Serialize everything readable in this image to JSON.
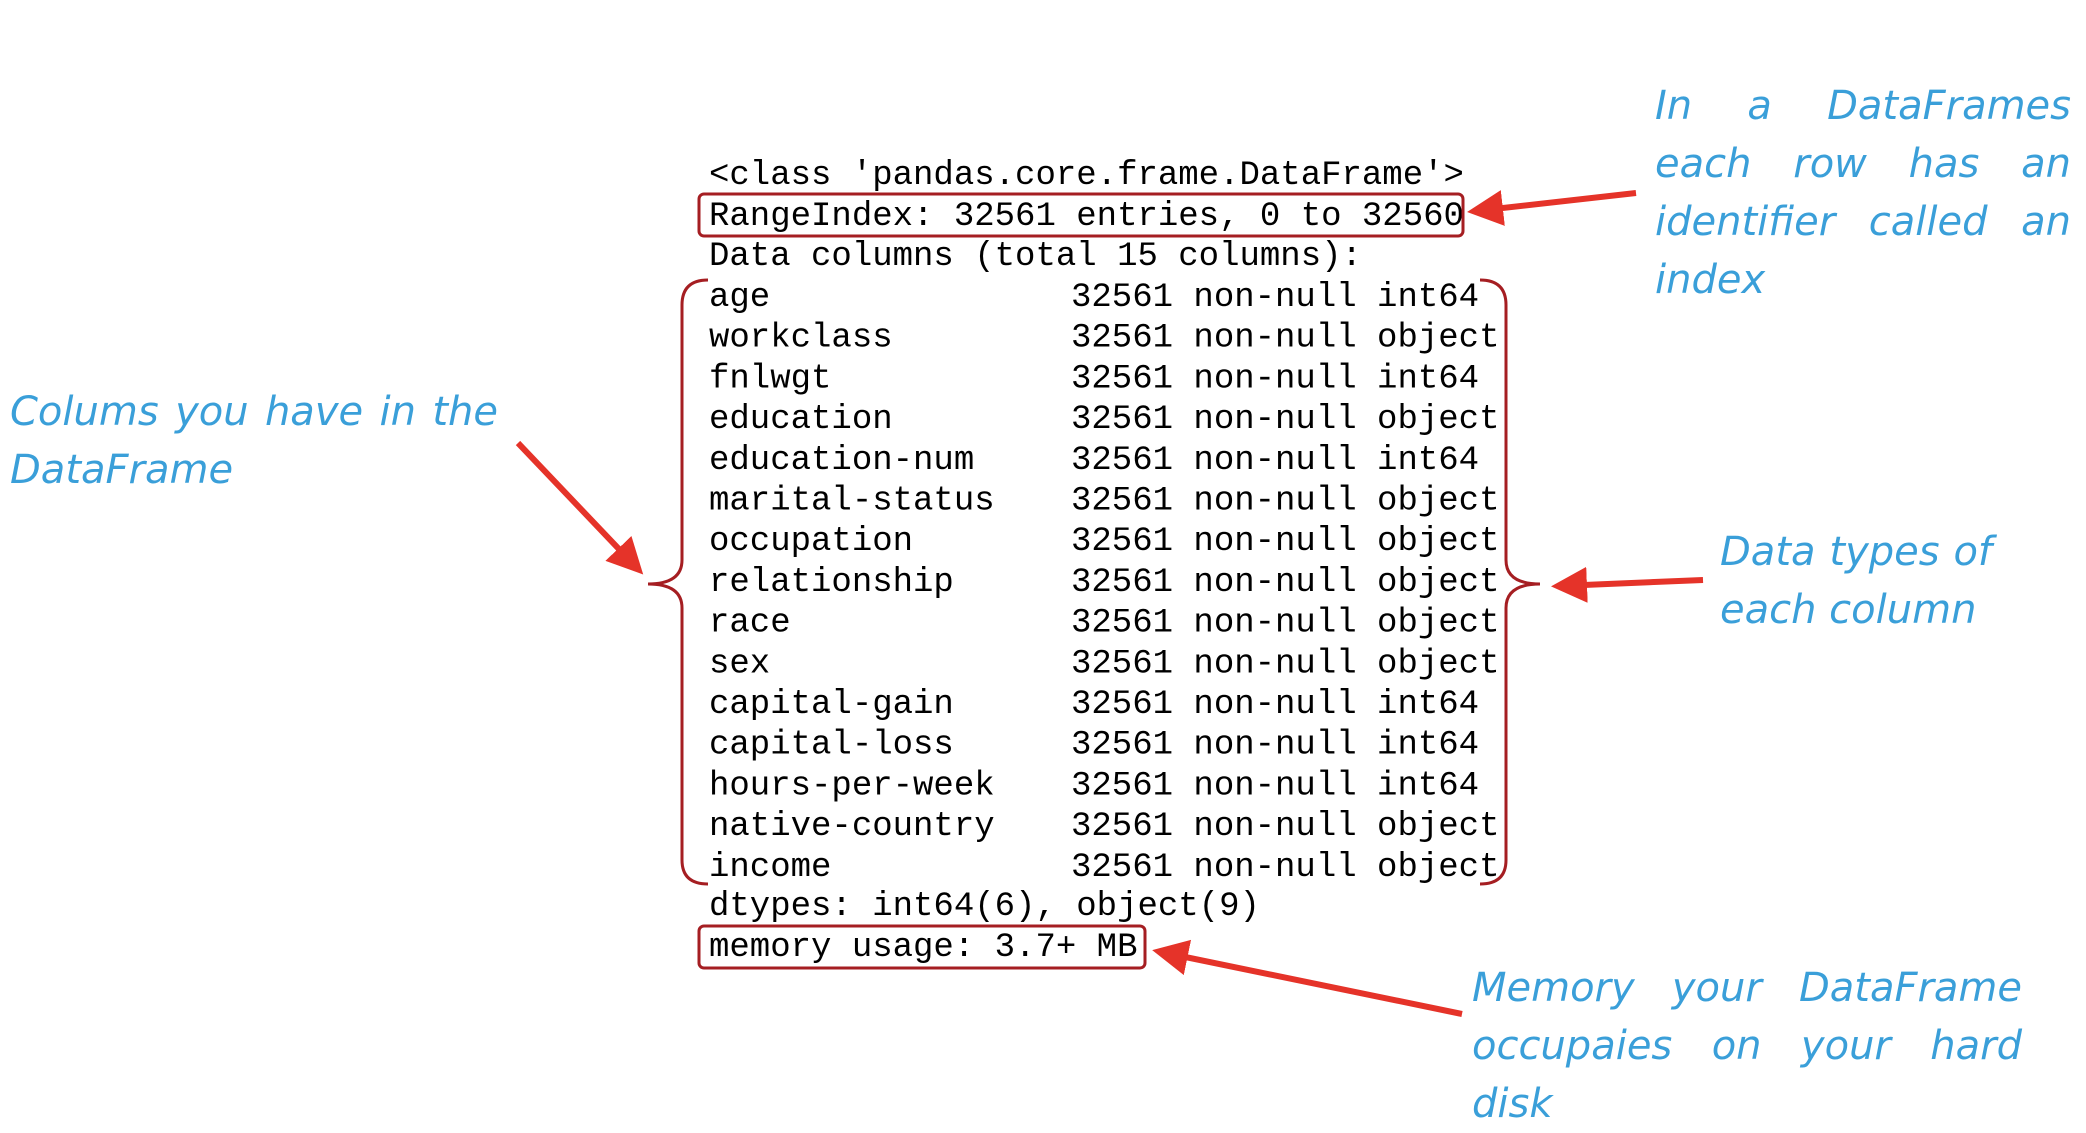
{
  "output": {
    "class_line": "<class 'pandas.core.frame.DataFrame'>",
    "range_index": "RangeIndex: 32561 entries, 0 to 32560",
    "columns_header": "Data columns (total 15 columns):",
    "columns": [
      {
        "name": "age",
        "info": "32561 non-null int64"
      },
      {
        "name": "workclass",
        "info": "32561 non-null object"
      },
      {
        "name": "fnlwgt",
        "info": "32561 non-null int64"
      },
      {
        "name": "education",
        "info": "32561 non-null object"
      },
      {
        "name": "education-num",
        "info": "32561 non-null int64"
      },
      {
        "name": "marital-status",
        "info": "32561 non-null object"
      },
      {
        "name": "occupation",
        "info": "32561 non-null object"
      },
      {
        "name": "relationship",
        "info": "32561 non-null object"
      },
      {
        "name": "race",
        "info": "32561 non-null object"
      },
      {
        "name": "sex",
        "info": "32561 non-null object"
      },
      {
        "name": "capital-gain",
        "info": "32561 non-null int64"
      },
      {
        "name": "capital-loss",
        "info": "32561 non-null int64"
      },
      {
        "name": "hours-per-week",
        "info": "32561 non-null int64"
      },
      {
        "name": "native-country",
        "info": "32561 non-null object"
      },
      {
        "name": "income",
        "info": "32561 non-null object"
      }
    ],
    "dtypes_line": "dtypes: int64(6), object(9)",
    "memory_line": "memory usage: 3.7+ MB"
  },
  "annotations": {
    "index_note": [
      "In a DataFrames",
      "each row has an",
      "identifier called an",
      "index"
    ],
    "columns_note": [
      "Colums you have in the",
      "DataFrame"
    ],
    "dtypes_note": [
      "Data types of",
      "each column"
    ],
    "memory_note": [
      "Memory your DataFrame",
      "occupaies on your hard disk"
    ]
  },
  "colors": {
    "annotation_text": "#3a9fd9",
    "arrow": "#e53329",
    "box": "#a51e22",
    "brace": "#a51e22"
  }
}
